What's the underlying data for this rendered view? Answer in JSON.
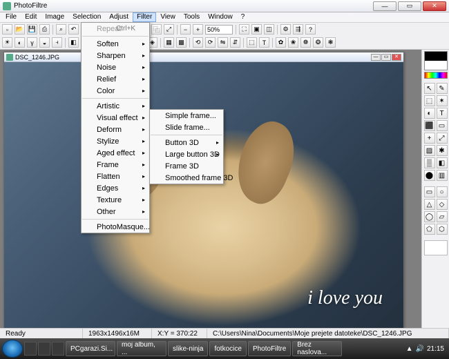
{
  "window": {
    "app_title": "PhotoFiltre"
  },
  "window_controls": {
    "min": "—",
    "max": "▭",
    "close": "✕"
  },
  "menubar": [
    "File",
    "Edit",
    "Image",
    "Selection",
    "Adjust",
    "Filter",
    "View",
    "Tools",
    "Window",
    "?"
  ],
  "menubar_open_index": 5,
  "toolbar": {
    "zoom_value": "50%"
  },
  "filter_menu": {
    "repeat": {
      "label": "Repeat",
      "shortcut": "Ctrl+K",
      "enabled": false
    },
    "groups": [
      [
        "Soften",
        "Sharpen",
        "Noise",
        "Relief",
        "Color"
      ],
      [
        "Artistic",
        "Visual effect",
        "Deform",
        "Stylize",
        "Aged effect",
        "Frame",
        "Flatten",
        "Edges",
        "Texture",
        "Other"
      ],
      [
        "PhotoMasque..."
      ]
    ],
    "highlighted": "Frame"
  },
  "frame_submenu": {
    "groups": [
      [
        "Simple frame...",
        "Slide frame..."
      ],
      [
        "Button 3D",
        "Large button 3D",
        "Frame 3D",
        "Smoothed frame 3D"
      ]
    ],
    "submenu_items": [
      "Button 3D",
      "Large button 3D"
    ]
  },
  "document": {
    "title": "DSC_1246.JPG",
    "overlay_text": "i love you"
  },
  "status": {
    "ready": "Ready",
    "dims": "1963x1496x16M",
    "cursor": "X:Y = 370:22",
    "path": "C:\\Users\\Nina\\Documents\\Moje prejete datoteke\\DSC_1246.JPG"
  },
  "side_tools": [
    "↖",
    "✎",
    "⬚",
    "✶",
    "◐",
    "T",
    "⬛",
    "▭",
    "+",
    "⤢",
    "▨",
    "✱",
    "▒",
    "◧",
    "⬤",
    "▥"
  ],
  "side_shapes": [
    "▭",
    "○",
    "△",
    "◇",
    "◯",
    "▱",
    "⬠",
    "⬡"
  ],
  "taskbar": {
    "tasks": [
      "PCgarazi.Si...",
      "moj album, ...",
      "slike-ninja",
      "fotkocice",
      "PhotoFiltre",
      "Brez naslova..."
    ],
    "clock": "21:15"
  }
}
